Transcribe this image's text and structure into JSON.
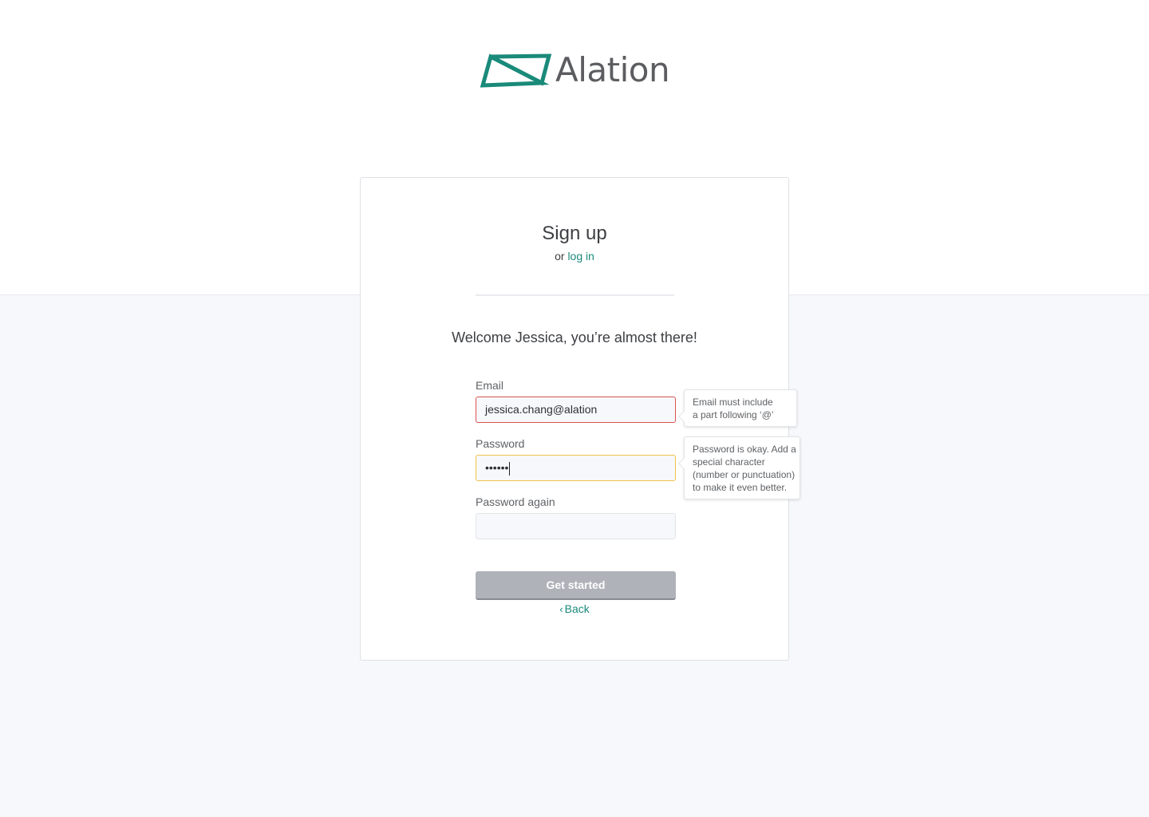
{
  "brand": {
    "name": "Alation",
    "color": "#1a8a7a",
    "icon": "alation-bowtie-logo-icon"
  },
  "signup": {
    "title": "Sign up",
    "alt_prefix": "or",
    "alt_link": "log in",
    "welcome": "Welcome Jessica, you’re almost there!"
  },
  "form": {
    "email": {
      "label": "Email",
      "value": "jessica.chang@alation",
      "state": "error",
      "tooltip": [
        "Email must include",
        "a part following ‘@’"
      ]
    },
    "password": {
      "label": "Password",
      "value": "••••••",
      "state": "warning",
      "tooltip": [
        "Password is okay. Add a",
        "special character",
        "(number or punctuation)",
        "to make it even better."
      ]
    },
    "password_again": {
      "label": "Password again",
      "value": ""
    },
    "submit_label": "Get started",
    "back_label": "Back",
    "back_icon": "chevron-left-icon"
  },
  "colors": {
    "error": "#d9534f",
    "warning": "#f0c34e",
    "button_disabled": "#afb2b9"
  }
}
